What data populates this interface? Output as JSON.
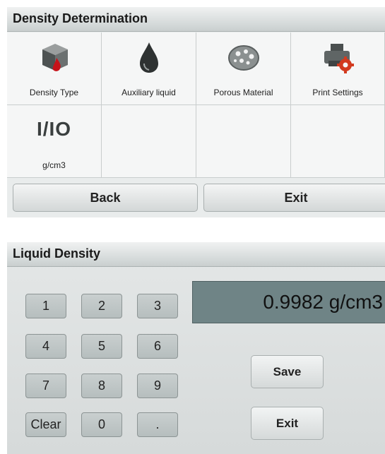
{
  "density_panel": {
    "title": "Density Determination",
    "items": [
      {
        "label": "Density Type",
        "icon": "density-cube-icon"
      },
      {
        "label": "Auxiliary liquid",
        "icon": "water-drop-icon"
      },
      {
        "label": "Porous Material",
        "icon": "porous-stone-icon"
      },
      {
        "label": "Print Settings",
        "icon": "printer-gear-icon"
      },
      {
        "label": "g/cm3",
        "icon_text": "I/IO",
        "icon": "unit-io-icon"
      }
    ],
    "back_label": "Back",
    "exit_label": "Exit"
  },
  "liquid_panel": {
    "title": "Liquid Density",
    "display_value": "0.9982 g/cm3",
    "keys": [
      "1",
      "2",
      "3",
      "4",
      "5",
      "6",
      "7",
      "8",
      "9",
      "Clear",
      "0",
      "."
    ],
    "save_label": "Save",
    "exit_label": "Exit"
  },
  "colors": {
    "display_bg": "#6f8486",
    "panel_bg": "#e9ecec",
    "gear_red": "#d23a1f"
  }
}
